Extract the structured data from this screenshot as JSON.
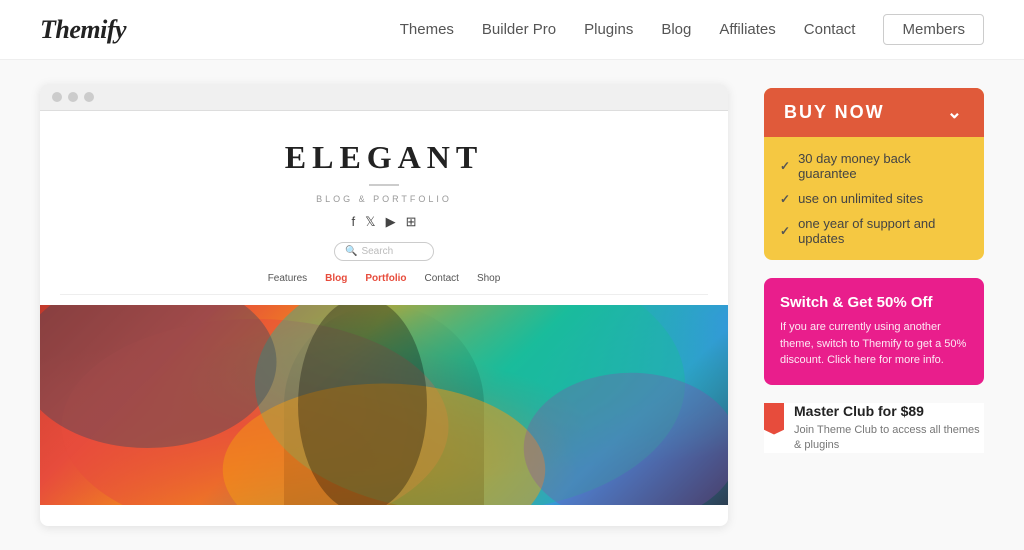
{
  "header": {
    "logo": "Themify",
    "nav": {
      "themes": "Themes",
      "builder_pro": "Builder Pro",
      "plugins": "Plugins",
      "blog": "Blog",
      "affiliates": "Affiliates",
      "contact": "Contact",
      "members": "Members"
    }
  },
  "theme_preview": {
    "title": "ELEGANT",
    "subtitle": "Blog & Portfolio",
    "search_placeholder": "Search",
    "nav_items": [
      "Features",
      "Blog",
      "Portfolio",
      "Contact",
      "Shop"
    ]
  },
  "sidebar": {
    "buy_now_label": "BUY NOW",
    "features": [
      "30 day money back guarantee",
      "use on unlimited sites",
      "one year of support and updates"
    ],
    "switch_title": "Switch & Get 50% Off",
    "switch_text": "If you are currently using another theme, switch to Themify to get a 50% discount. Click here for more info.",
    "master_club_title": "Master Club for $89",
    "master_club_desc": "Join Theme Club to access all themes & plugins"
  }
}
